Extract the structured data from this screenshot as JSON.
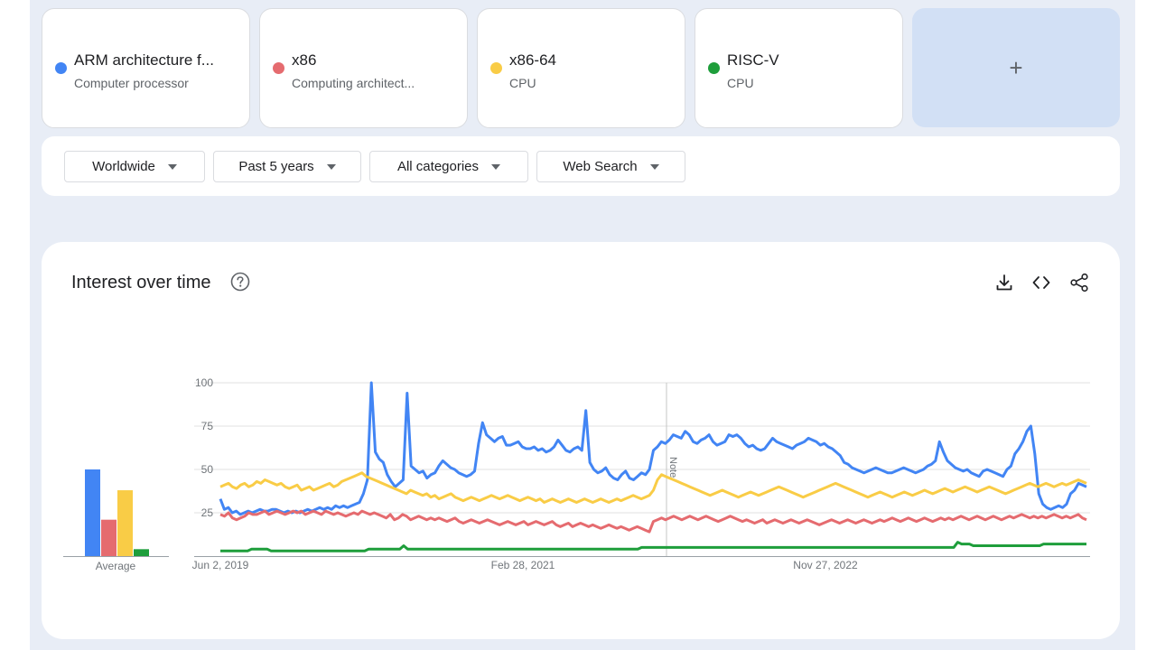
{
  "terms": [
    {
      "title": "ARM architecture f...",
      "subtitle": "Computer processor",
      "color": "#4285f4"
    },
    {
      "title": "x86",
      "subtitle": "Computing architect...",
      "color": "#e56b6f"
    },
    {
      "title": "x86-64",
      "subtitle": "CPU",
      "color": "#f9cc46"
    },
    {
      "title": "RISC-V",
      "subtitle": "CPU",
      "color": "#1e9e3b"
    }
  ],
  "add_term": {
    "label": "+"
  },
  "filters": {
    "region": "Worldwide",
    "time": "Past 5 years",
    "category": "All categories",
    "search_type": "Web Search"
  },
  "panel": {
    "title": "Interest over time"
  },
  "icons": [
    "help-icon",
    "download-icon",
    "embed-icon",
    "share-icon"
  ],
  "chart_data": {
    "type": "line",
    "y_ticks": [
      25,
      50,
      75,
      100
    ],
    "ylim": [
      0,
      100
    ],
    "x_tick_labels": [
      "Jun 2, 2019",
      "Feb 28, 2021",
      "Nov 27, 2022"
    ],
    "annotation": "Note",
    "average_label": "Average",
    "averages": [
      50,
      21,
      38,
      4
    ],
    "series": [
      {
        "color": "#4285f4",
        "values": [
          33,
          27,
          28,
          25,
          26,
          24,
          25,
          26,
          25,
          26,
          27,
          26,
          26,
          27,
          27,
          26,
          25,
          26,
          25,
          26,
          25,
          26,
          27,
          26,
          27,
          28,
          27,
          28,
          27,
          29,
          28,
          29,
          28,
          29,
          30,
          31,
          36,
          44,
          100,
          60,
          56,
          54,
          47,
          43,
          40,
          42,
          44,
          94,
          52,
          50,
          48,
          49,
          45,
          47,
          48,
          52,
          55,
          53,
          51,
          50,
          48,
          47,
          46,
          47,
          49,
          65,
          77,
          70,
          68,
          66,
          68,
          69,
          64,
          64,
          65,
          66,
          63,
          62,
          62,
          63,
          61,
          62,
          60,
          61,
          63,
          67,
          64,
          61,
          60,
          62,
          63,
          61,
          84,
          54,
          50,
          48,
          49,
          51,
          47,
          45,
          44,
          47,
          49,
          45,
          44,
          46,
          48,
          47,
          50,
          61,
          63,
          66,
          65,
          67,
          70,
          69,
          68,
          72,
          70,
          66,
          65,
          67,
          68,
          70,
          66,
          64,
          65,
          66,
          70,
          69,
          70,
          68,
          65,
          63,
          64,
          62,
          61,
          62,
          65,
          68,
          66,
          65,
          64,
          63,
          62,
          64,
          65,
          66,
          68,
          67,
          66,
          64,
          65,
          63,
          62,
          60,
          58,
          54,
          53,
          51,
          50,
          49,
          48,
          49,
          50,
          51,
          50,
          49,
          48,
          48,
          49,
          50,
          51,
          50,
          49,
          48,
          49,
          50,
          52,
          53,
          55,
          66,
          60,
          55,
          53,
          51,
          50,
          49,
          50,
          48,
          47,
          46,
          49,
          50,
          49,
          48,
          47,
          46,
          50,
          52,
          59,
          62,
          66,
          72,
          75,
          59,
          36,
          30,
          28,
          27,
          28,
          29,
          28,
          30,
          36,
          38,
          42,
          41,
          40
        ]
      },
      {
        "color": "#e56b6f",
        "values": [
          24,
          23,
          25,
          22,
          21,
          22,
          23,
          25,
          24,
          24,
          25,
          26,
          24,
          25,
          26,
          25,
          24,
          25,
          26,
          25,
          26,
          24,
          25,
          26,
          25,
          24,
          26,
          25,
          24,
          25,
          24,
          23,
          24,
          25,
          24,
          26,
          25,
          24,
          25,
          24,
          23,
          22,
          24,
          21,
          22,
          24,
          23,
          21,
          22,
          23,
          22,
          21,
          22,
          21,
          22,
          21,
          20,
          21,
          22,
          20,
          19,
          20,
          21,
          20,
          19,
          20,
          21,
          20,
          19,
          18,
          19,
          20,
          19,
          18,
          19,
          20,
          18,
          19,
          20,
          19,
          18,
          19,
          20,
          18,
          17,
          18,
          19,
          17,
          18,
          19,
          18,
          17,
          18,
          17,
          16,
          17,
          18,
          17,
          16,
          17,
          16,
          15,
          16,
          17,
          16,
          15,
          14,
          20,
          21,
          22,
          21,
          22,
          23,
          22,
          21,
          22,
          23,
          22,
          21,
          22,
          23,
          22,
          21,
          20,
          21,
          22,
          23,
          22,
          21,
          20,
          21,
          20,
          19,
          20,
          21,
          19,
          20,
          21,
          20,
          19,
          20,
          21,
          20,
          19,
          20,
          21,
          20,
          19,
          18,
          19,
          20,
          21,
          20,
          19,
          20,
          21,
          20,
          19,
          20,
          21,
          20,
          19,
          20,
          21,
          20,
          21,
          22,
          21,
          20,
          21,
          22,
          21,
          20,
          21,
          22,
          21,
          20,
          21,
          22,
          21,
          22,
          21,
          22,
          23,
          22,
          21,
          22,
          23,
          22,
          21,
          22,
          23,
          22,
          21,
          22,
          23,
          22,
          23,
          24,
          23,
          22,
          23,
          22,
          23,
          22,
          23,
          24,
          23,
          22,
          23,
          22,
          23,
          24,
          22,
          21
        ]
      },
      {
        "color": "#f9cc46",
        "values": [
          40,
          41,
          42,
          40,
          39,
          41,
          42,
          40,
          41,
          43,
          42,
          44,
          43,
          42,
          41,
          42,
          40,
          39,
          40,
          41,
          38,
          39,
          40,
          38,
          39,
          40,
          41,
          42,
          40,
          41,
          43,
          44,
          45,
          46,
          47,
          48,
          46,
          45,
          44,
          43,
          42,
          41,
          40,
          39,
          38,
          37,
          36,
          38,
          37,
          36,
          35,
          36,
          34,
          35,
          33,
          34,
          35,
          36,
          34,
          33,
          32,
          33,
          34,
          33,
          32,
          33,
          34,
          35,
          34,
          33,
          34,
          35,
          34,
          33,
          32,
          33,
          34,
          33,
          32,
          33,
          31,
          32,
          33,
          32,
          31,
          32,
          33,
          32,
          31,
          32,
          33,
          32,
          31,
          32,
          33,
          32,
          31,
          32,
          33,
          32,
          33,
          34,
          35,
          34,
          33,
          34,
          35,
          38,
          44,
          47,
          46,
          45,
          44,
          43,
          42,
          41,
          40,
          39,
          38,
          37,
          36,
          35,
          36,
          37,
          38,
          37,
          36,
          35,
          34,
          35,
          36,
          37,
          36,
          35,
          36,
          37,
          38,
          39,
          40,
          39,
          38,
          37,
          36,
          35,
          34,
          35,
          36,
          37,
          38,
          39,
          40,
          41,
          42,
          41,
          40,
          39,
          38,
          37,
          36,
          35,
          34,
          35,
          36,
          37,
          36,
          35,
          34,
          35,
          36,
          37,
          36,
          35,
          36,
          37,
          38,
          37,
          36,
          37,
          38,
          39,
          38,
          37,
          38,
          39,
          40,
          39,
          38,
          37,
          38,
          39,
          40,
          39,
          38,
          37,
          36,
          37,
          38,
          39,
          40,
          41,
          42,
          41,
          40,
          41,
          42,
          41,
          40,
          41,
          42,
          41,
          42,
          43,
          44,
          43,
          42
        ]
      },
      {
        "color": "#1e9e3b",
        "values": [
          3,
          3,
          3,
          3,
          3,
          3,
          3,
          3,
          4,
          4,
          4,
          4,
          4,
          3,
          3,
          3,
          3,
          3,
          3,
          3,
          3,
          3,
          3,
          3,
          3,
          3,
          3,
          3,
          3,
          3,
          3,
          3,
          3,
          3,
          3,
          3,
          3,
          3,
          4,
          4,
          4,
          4,
          4,
          4,
          4,
          4,
          4,
          6,
          4,
          4,
          4,
          4,
          4,
          4,
          4,
          4,
          4,
          4,
          4,
          4,
          4,
          4,
          4,
          4,
          4,
          4,
          4,
          4,
          4,
          4,
          4,
          4,
          4,
          4,
          4,
          4,
          4,
          4,
          4,
          4,
          4,
          4,
          4,
          4,
          4,
          4,
          4,
          4,
          4,
          4,
          4,
          4,
          4,
          4,
          4,
          4,
          4,
          4,
          4,
          4,
          4,
          4,
          4,
          4,
          4,
          4,
          4,
          4,
          5,
          5,
          5,
          5,
          5,
          5,
          5,
          5,
          5,
          5,
          5,
          5,
          5,
          5,
          5,
          5,
          5,
          5,
          5,
          5,
          5,
          5,
          5,
          5,
          5,
          5,
          5,
          5,
          5,
          5,
          5,
          5,
          5,
          5,
          5,
          5,
          5,
          5,
          5,
          5,
          5,
          5,
          5,
          5,
          5,
          5,
          5,
          5,
          5,
          5,
          5,
          5,
          5,
          5,
          5,
          5,
          5,
          5,
          5,
          5,
          5,
          5,
          5,
          5,
          5,
          5,
          5,
          5,
          5,
          5,
          5,
          5,
          5,
          5,
          5,
          5,
          5,
          5,
          5,
          5,
          5,
          8,
          7,
          7,
          7,
          6,
          6,
          6,
          6,
          6,
          6,
          6,
          6,
          6,
          6,
          6,
          6,
          6,
          6,
          6,
          6,
          6,
          6,
          7,
          7,
          7,
          7,
          7,
          7,
          7,
          7,
          7,
          7,
          7,
          7
        ]
      }
    ]
  }
}
